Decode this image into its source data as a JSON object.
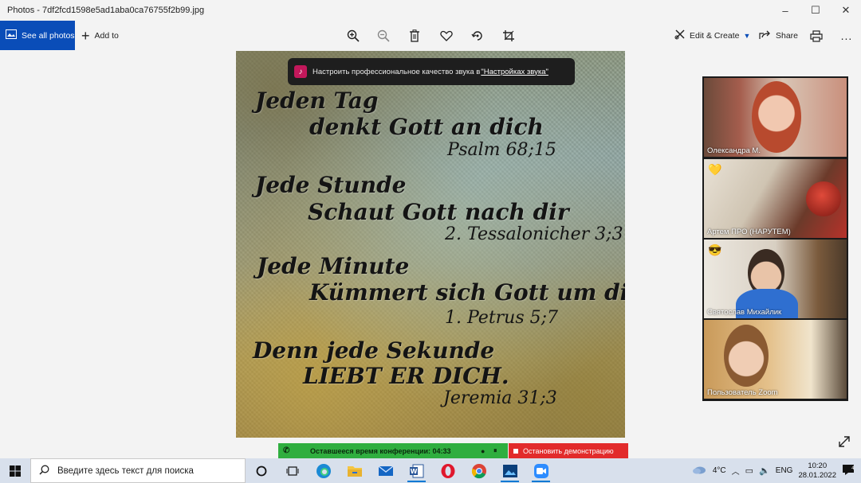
{
  "window": {
    "title": "Photos - 7df2fcd1598e5ad1aba0ca76755f2b99.jpg",
    "controls": [
      "–",
      "☐",
      "✕"
    ]
  },
  "toolbar": {
    "see_all_label": "See all photos",
    "add_to_label": "Add to",
    "edit_create_label": "Edit & Create",
    "share_label": "Share",
    "more_label": "...",
    "accent": "#0a4db8",
    "icons": [
      "zoom-in-icon",
      "zoom-out-icon",
      "delete-icon",
      "favorite-icon",
      "rotate-icon",
      "crop-icon",
      "print-icon"
    ]
  },
  "notice": {
    "text": "Настроить профессиональное качество звука в ",
    "link": "\"Настройках звука\""
  },
  "photo": {
    "lines": [
      "Jeden Tag",
      "denkt Gott an dich",
      "Psalm 68;15",
      "Jede Stunde",
      "Schaut Gott nach dir",
      "2. Tessalonicher 3;3",
      "Jede Minute",
      "Kümmert sich Gott um dich",
      "1. Petrus 5;7",
      "Denn jede Sekunde",
      "LIEBT ER DICH.",
      "Jeremia 31;3"
    ]
  },
  "participants": [
    {
      "name": "Олександра М."
    },
    {
      "name": "Артем ПРО (НАРУТЕМ)",
      "emoji": "💛"
    },
    {
      "name": "Святослав Михайлик",
      "emoji": "😎"
    },
    {
      "name": "Пользователь Zoom"
    }
  ],
  "zoom_bar": {
    "timer_label": "Оставшееся время конференции: 04:33",
    "stop_label": "Остановить демонстрацию",
    "timer_color": "#2fae3f",
    "stop_color": "#e22b2b"
  },
  "taskbar": {
    "search_placeholder": "Введите здесь текст для поиска",
    "apps": [
      "cortana-icon",
      "task-view-icon",
      "edge-icon",
      "file-explorer-icon",
      "mail-icon",
      "word-icon",
      "opera-icon",
      "chrome-icon",
      "photos-icon",
      "zoom-icon"
    ],
    "weather": "4°C",
    "language": "ENG",
    "time": "10:20",
    "date": "28.01.2022"
  }
}
